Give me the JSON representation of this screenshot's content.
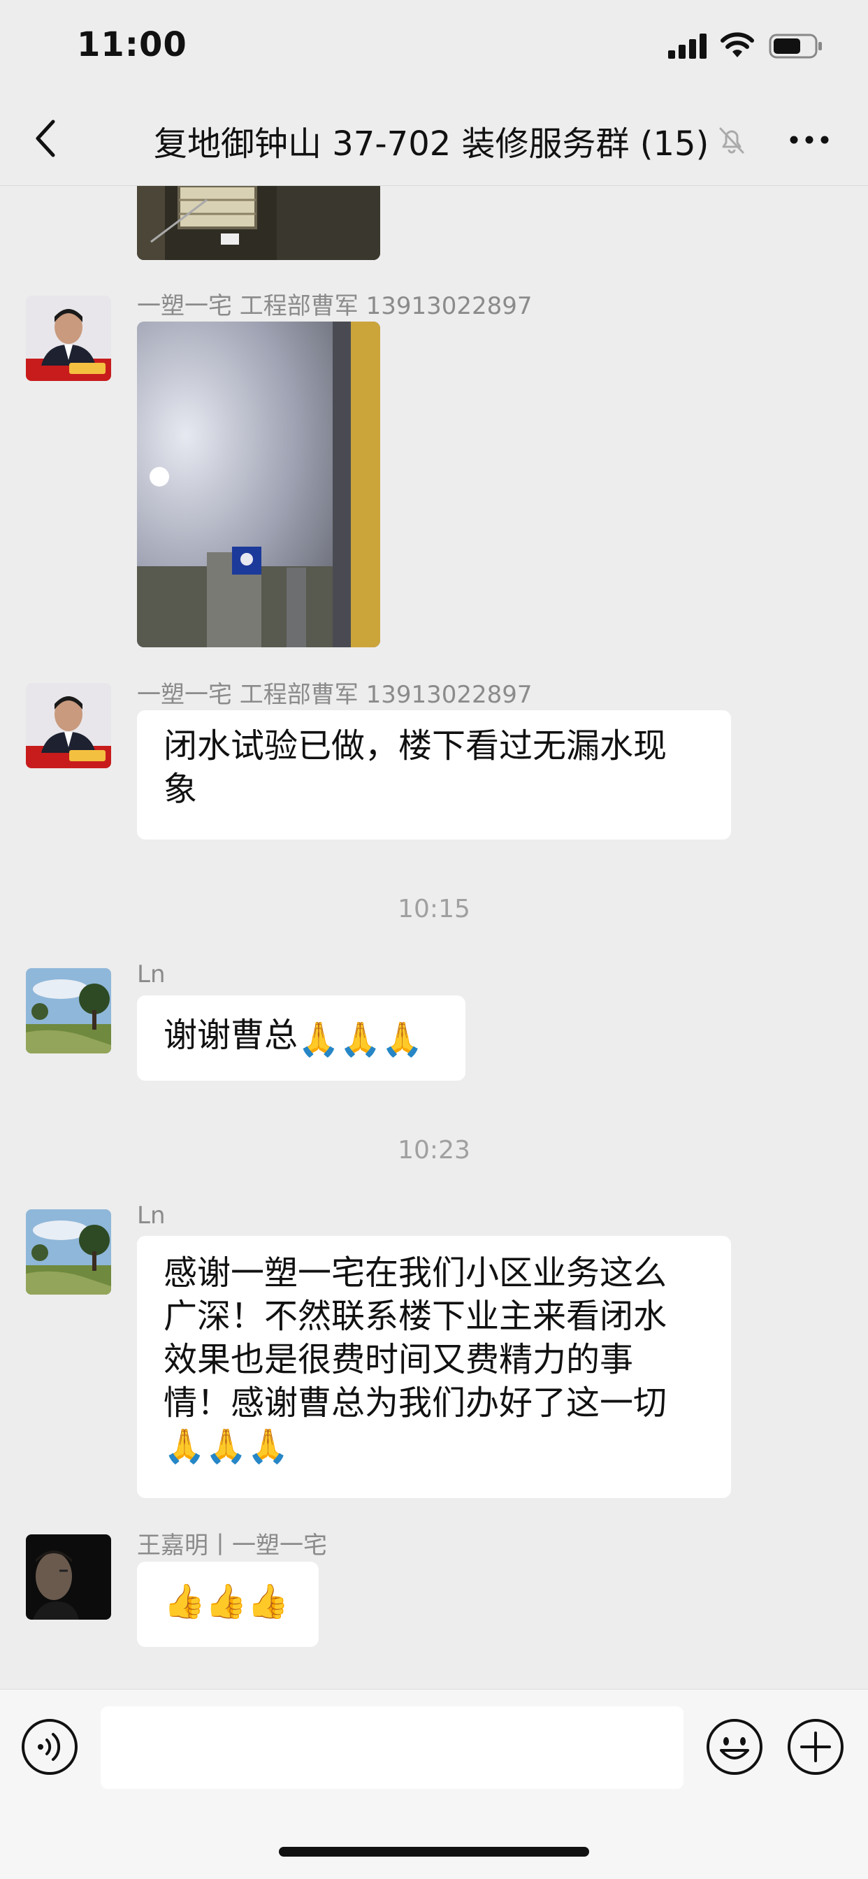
{
  "status_bar": {
    "time": "11:00"
  },
  "header": {
    "title": "复地御钟山 37-702 装修服务群 (15)"
  },
  "messages": [
    {
      "sender": "一塑一宅 工程部曹军 13913022897"
    },
    {
      "sender": "一塑一宅 工程部曹军 13913022897",
      "text": "闭水试验已做，楼下看过无漏水现象",
      "line1": "闭水试验已做，楼下看过无漏水现",
      "line2": "象"
    },
    {
      "timestamp": "10:15"
    },
    {
      "sender": "Ln",
      "text": "谢谢曹总",
      "emoji": "🙏🙏🙏"
    },
    {
      "timestamp": "10:23"
    },
    {
      "sender": "Ln",
      "lines": [
        "感谢一塑一宅在我们小区业务这么",
        "广深！不然联系楼下业主来看闭水",
        "效果也是很费时间又费精力的事",
        "情！感谢曹总为我们办好了这一切"
      ],
      "emoji": "🙏🙏🙏"
    },
    {
      "sender": "王嘉明丨一塑一宅",
      "emoji": "👍👍👍"
    }
  ],
  "colors": {
    "background": "#ededed",
    "bubble": "#ffffff",
    "sender": "#8b8b8b",
    "timestamp": "#a0a0a0"
  }
}
